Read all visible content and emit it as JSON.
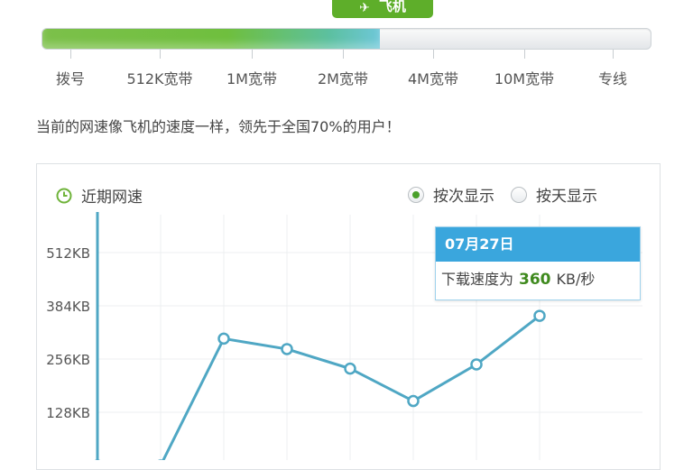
{
  "meter": {
    "badge_label": "飞机",
    "badge_icon": "airplane-icon",
    "progress_fraction": 0.555,
    "levels": [
      "拨号",
      "512K宽带",
      "1M宽带",
      "2M宽带",
      "4M宽带",
      "10M宽带",
      "专线"
    ]
  },
  "status_text": "当前的网速像飞机的速度一样，领先于全国70%的用户！",
  "panel": {
    "title": "近期网速",
    "title_icon": "clock-icon",
    "view_options": [
      {
        "label": "按次显示",
        "selected": true
      },
      {
        "label": "按天显示",
        "selected": false
      }
    ]
  },
  "tooltip": {
    "date": "07月27日",
    "prefix": "下载速度为",
    "value": "360",
    "unit": "KB/秒"
  },
  "colors": {
    "accent_green": "#5eae2a",
    "line": "#4fa7c4",
    "tooltip_blue": "#3aa6dd"
  },
  "chart_data": {
    "type": "line",
    "y_ticks": [
      {
        "label": "128KB",
        "value": 128
      },
      {
        "label": "256KB",
        "value": 256
      },
      {
        "label": "384KB",
        "value": 384
      },
      {
        "label": "512KB",
        "value": 512
      }
    ],
    "ylim": [
      0,
      560
    ],
    "values": [
      0,
      0,
      305,
      280,
      233,
      155,
      243,
      360
    ],
    "grid": true
  }
}
